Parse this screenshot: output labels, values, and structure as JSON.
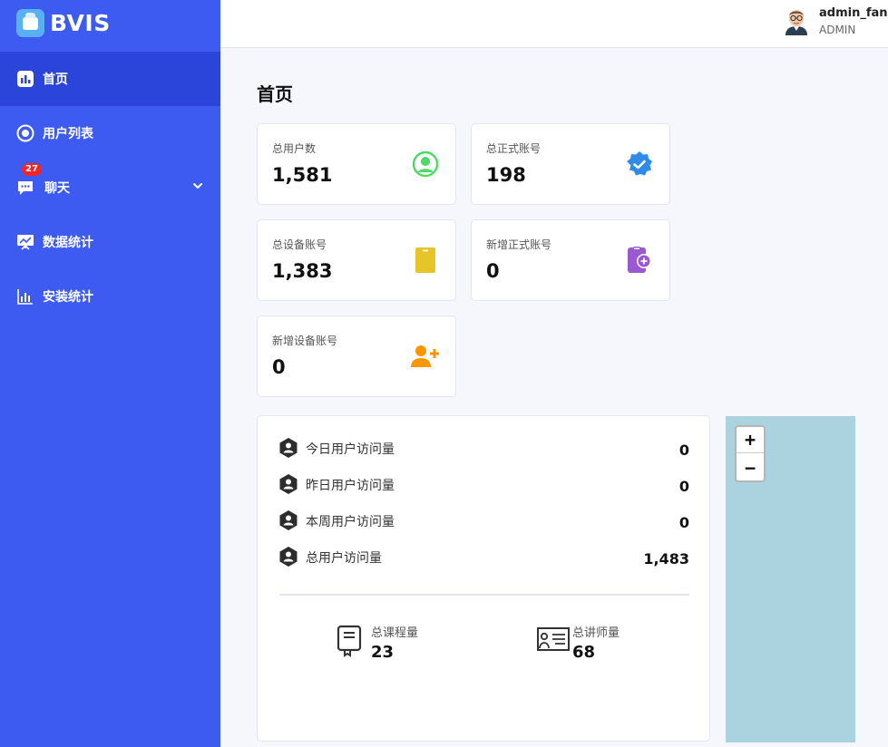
{
  "brand": {
    "name": "BVIS"
  },
  "sidebar": {
    "items": [
      {
        "label": "首页",
        "icon": "chart-bar-icon",
        "active": true
      },
      {
        "label": "用户列表",
        "icon": "user-circle-icon"
      },
      {
        "label": "聊天",
        "icon": "chat-icon",
        "badge": "27"
      },
      {
        "label": "数据统计",
        "icon": "presentation-icon"
      },
      {
        "label": "安装统计",
        "icon": "bar-chart-icon"
      }
    ]
  },
  "header": {
    "user_name": "admin_fang",
    "user_role": "ADMIN"
  },
  "page": {
    "title": "首页"
  },
  "stats": [
    {
      "label": "总用户数",
      "value": "1,581",
      "icon": "user-circle-icon",
      "color": "#4cd964"
    },
    {
      "label": "总正式账号",
      "value": "198",
      "icon": "verified-badge-icon",
      "color": "#2f8ae8"
    },
    {
      "label": "总设备账号",
      "value": "1,383",
      "icon": "device-icon",
      "color": "#e5c52a"
    },
    {
      "label": "新增正式账号",
      "value": "0",
      "icon": "clipboard-plus-icon",
      "color": "#9b59d0"
    },
    {
      "label": "新增设备账号",
      "value": "0",
      "icon": "user-plus-icon",
      "color": "#ff9500"
    }
  ],
  "visits": [
    {
      "label": "今日用户访问量",
      "value": "0"
    },
    {
      "label": "昨日用户访问量",
      "value": "0"
    },
    {
      "label": "本周用户访问量",
      "value": "0"
    },
    {
      "label": "总用户访问量",
      "value": "1,483"
    }
  ],
  "summary": [
    {
      "label": "总课程量",
      "value": "23",
      "icon": "book-icon"
    },
    {
      "label": "总讲师量",
      "value": "68",
      "icon": "teacher-board-icon"
    }
  ],
  "map": {
    "zoom_in": "+",
    "zoom_out": "−"
  },
  "colors": {
    "sidebar": "#3d5af1",
    "sidebar_active": "#2b44d9",
    "map_water": "#aad3df",
    "badge": "#f0262b"
  }
}
